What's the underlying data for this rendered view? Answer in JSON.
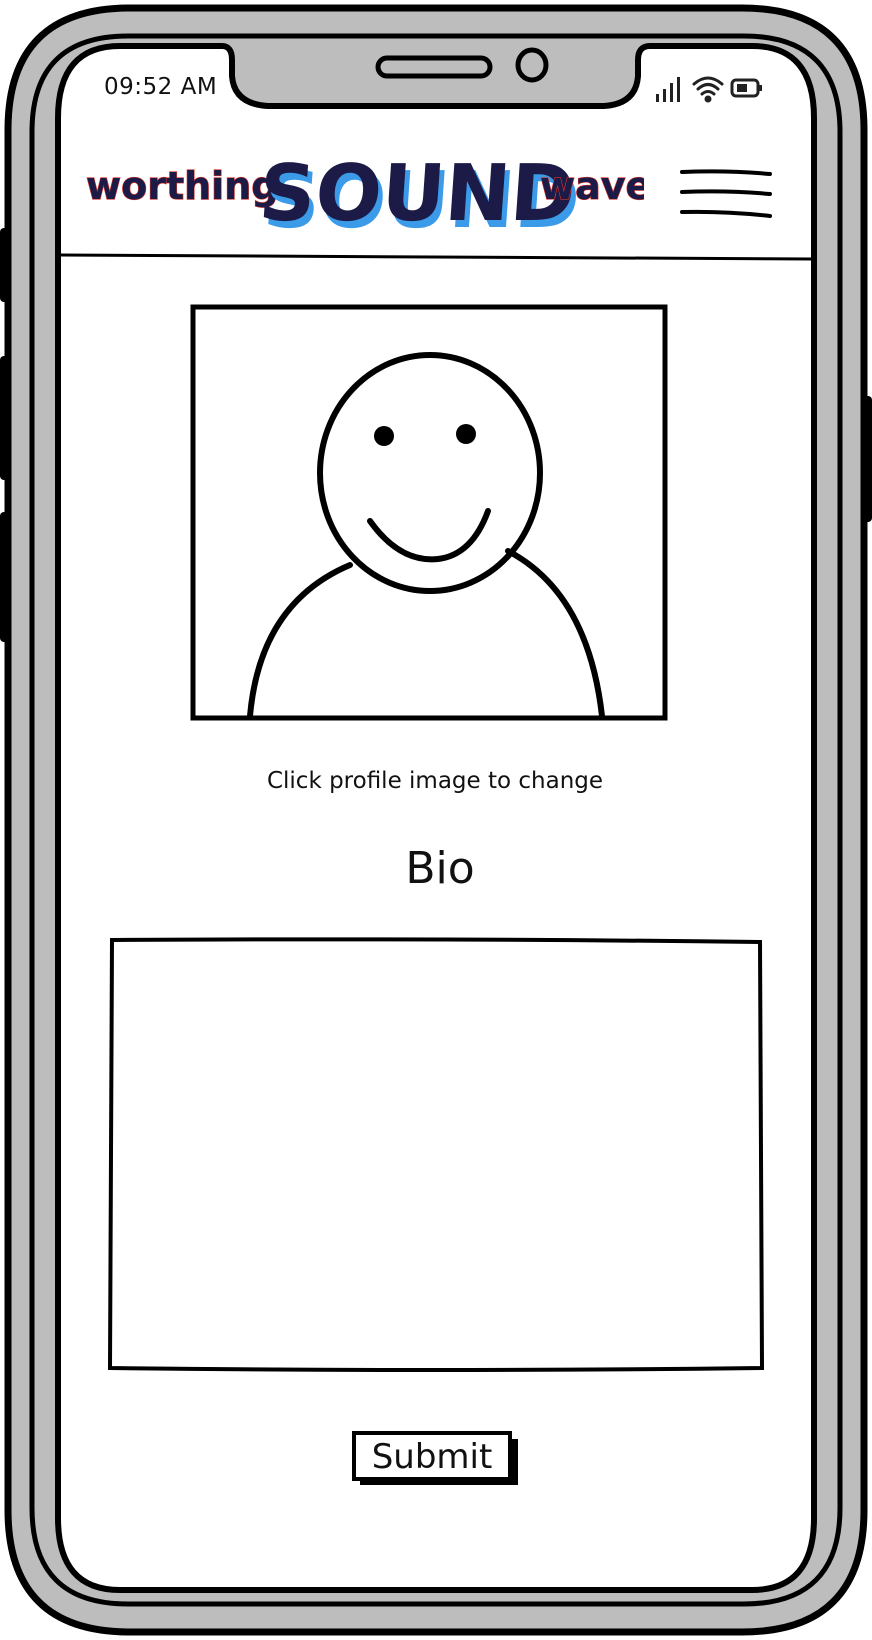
{
  "status_bar": {
    "time": "09:52 AM",
    "signal_icon": "signal-bars-icon",
    "wifi_icon": "wifi-icon",
    "battery_icon": "battery-icon"
  },
  "header": {
    "logo": {
      "word_left": "worthing",
      "word_center": "SOUND",
      "word_right": "wave"
    },
    "menu_icon": "hamburger-menu-icon"
  },
  "profile": {
    "image_icon": "avatar-placeholder-icon",
    "hint": "Click profile image to change"
  },
  "bio": {
    "heading": "Bio",
    "value": ""
  },
  "form": {
    "submit_label": "Submit"
  },
  "colors": {
    "frame_gray": "#bdbdbd",
    "outline": "#000000",
    "logo_navy": "#1c1a46",
    "logo_blue_shadow": "#3b9be8",
    "logo_red_shadow": "#d9342b"
  }
}
